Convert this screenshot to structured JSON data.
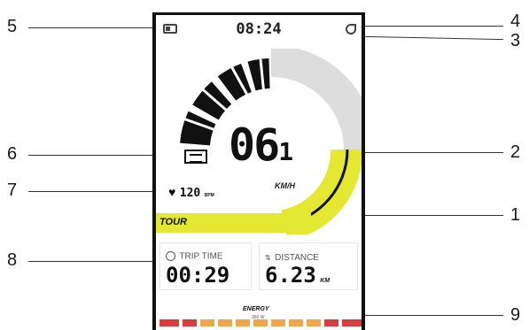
{
  "display": {
    "clock": "08:24",
    "speed_int": "06",
    "speed_dec": "1",
    "speed_unit": "KM/H",
    "assist_mode": "TOUR",
    "heart_rate": "120",
    "heart_rate_unit": "BPM",
    "trip_time_label": "TRIP TIME",
    "trip_time_value": "00:29",
    "distance_label": "DISTANCE",
    "distance_value": "6.23",
    "distance_unit": "KM",
    "energy_label": "ENERGY",
    "energy_sub": "360 W"
  },
  "callouts": [
    "1",
    "2",
    "3",
    "4",
    "5",
    "6",
    "7",
    "8",
    "9"
  ],
  "colors": {
    "speed_arc": "#e4e832",
    "power_arc": "#111111",
    "gauge_track": "#dddddd",
    "energy_high": "#d83c3c",
    "energy_mid": "#f0a64a"
  }
}
